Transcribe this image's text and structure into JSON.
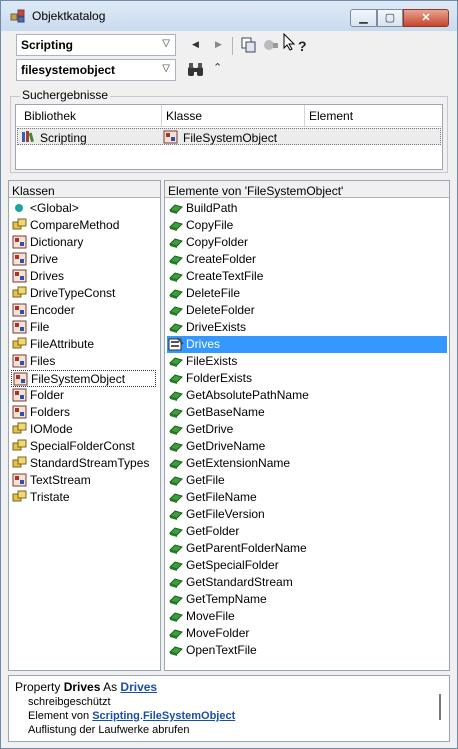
{
  "window": {
    "title": "Objektkatalog"
  },
  "toolbar": {
    "library_value": "Scripting",
    "search_value": "filesystemobject"
  },
  "search_results": {
    "group_label": "Suchergebnisse",
    "columns": [
      "Bibliothek",
      "Klasse",
      "Element"
    ],
    "rows": [
      {
        "library": "Scripting",
        "class": "FileSystemObject",
        "element": ""
      }
    ]
  },
  "classes": {
    "header": "Klassen",
    "items": [
      {
        "label": "<Global>",
        "icon": "global-icon"
      },
      {
        "label": "CompareMethod",
        "icon": "enum-icon"
      },
      {
        "label": "Dictionary",
        "icon": "class-icon"
      },
      {
        "label": "Drive",
        "icon": "class-icon"
      },
      {
        "label": "Drives",
        "icon": "class-icon"
      },
      {
        "label": "DriveTypeConst",
        "icon": "enum-icon"
      },
      {
        "label": "Encoder",
        "icon": "class-icon"
      },
      {
        "label": "File",
        "icon": "class-icon"
      },
      {
        "label": "FileAttribute",
        "icon": "enum-icon"
      },
      {
        "label": "Files",
        "icon": "class-icon"
      },
      {
        "label": "FileSystemObject",
        "icon": "class-icon"
      },
      {
        "label": "Folder",
        "icon": "class-icon"
      },
      {
        "label": "Folders",
        "icon": "class-icon"
      },
      {
        "label": "IOMode",
        "icon": "enum-icon"
      },
      {
        "label": "SpecialFolderConst",
        "icon": "enum-icon"
      },
      {
        "label": "StandardStreamTypes",
        "icon": "enum-icon"
      },
      {
        "label": "TextStream",
        "icon": "class-icon"
      },
      {
        "label": "Tristate",
        "icon": "enum-icon"
      }
    ],
    "focused_index": 10
  },
  "members": {
    "header": "Elemente von 'FileSystemObject'",
    "items": [
      {
        "label": "BuildPath",
        "icon": "method-icon"
      },
      {
        "label": "CopyFile",
        "icon": "method-icon"
      },
      {
        "label": "CopyFolder",
        "icon": "method-icon"
      },
      {
        "label": "CreateFolder",
        "icon": "method-icon"
      },
      {
        "label": "CreateTextFile",
        "icon": "method-icon"
      },
      {
        "label": "DeleteFile",
        "icon": "method-icon"
      },
      {
        "label": "DeleteFolder",
        "icon": "method-icon"
      },
      {
        "label": "DriveExists",
        "icon": "method-icon"
      },
      {
        "label": "Drives",
        "icon": "property-icon"
      },
      {
        "label": "FileExists",
        "icon": "method-icon"
      },
      {
        "label": "FolderExists",
        "icon": "method-icon"
      },
      {
        "label": "GetAbsolutePathName",
        "icon": "method-icon"
      },
      {
        "label": "GetBaseName",
        "icon": "method-icon"
      },
      {
        "label": "GetDrive",
        "icon": "method-icon"
      },
      {
        "label": "GetDriveName",
        "icon": "method-icon"
      },
      {
        "label": "GetExtensionName",
        "icon": "method-icon"
      },
      {
        "label": "GetFile",
        "icon": "method-icon"
      },
      {
        "label": "GetFileName",
        "icon": "method-icon"
      },
      {
        "label": "GetFileVersion",
        "icon": "method-icon"
      },
      {
        "label": "GetFolder",
        "icon": "method-icon"
      },
      {
        "label": "GetParentFolderName",
        "icon": "method-icon"
      },
      {
        "label": "GetSpecialFolder",
        "icon": "method-icon"
      },
      {
        "label": "GetStandardStream",
        "icon": "method-icon"
      },
      {
        "label": "GetTempName",
        "icon": "method-icon"
      },
      {
        "label": "MoveFile",
        "icon": "method-icon"
      },
      {
        "label": "MoveFolder",
        "icon": "method-icon"
      },
      {
        "label": "OpenTextFile",
        "icon": "method-icon"
      }
    ],
    "selected_index": 8
  },
  "info": {
    "prefix": "Property ",
    "member": "Drives",
    "as_text": " As ",
    "type_link": "Drives",
    "readonly": "schreibgeschützt",
    "member_of": "Element von ",
    "lib_link": "Scripting",
    "dot": ".",
    "class_link": "FileSystemObject",
    "description": "Auflistung der Laufwerke abrufen"
  }
}
